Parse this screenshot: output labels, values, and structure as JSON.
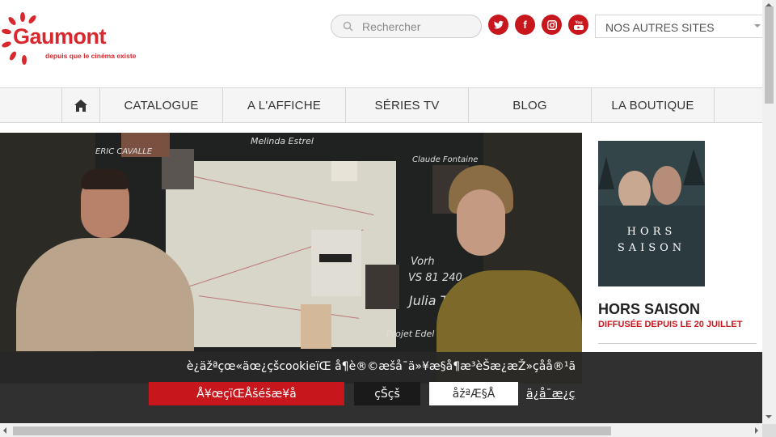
{
  "header": {
    "logo_word": "Gaumont",
    "logo_tagline": "depuis que le cinéma existe",
    "search_placeholder": "Rechercher",
    "social": [
      {
        "name": "twitter-icon",
        "glyph": "t"
      },
      {
        "name": "facebook-icon",
        "glyph": "f"
      },
      {
        "name": "instagram-icon",
        "glyph": "◎"
      },
      {
        "name": "youtube-icon",
        "glyph": "▶"
      }
    ],
    "sites_select": "NOS AUTRES SITES"
  },
  "nav": {
    "items": [
      "CATALOGUE",
      "A L'AFFICHE",
      "SÉRIES TV",
      "BLOG",
      "LA BOUTIQUE"
    ]
  },
  "hero": {
    "board_labels": [
      "Melinda Estrel",
      "ERIC CAVALLE",
      "Claude Fontaine",
      "Vorh",
      "VS 81 240",
      "Julia Tam",
      "Projet Edel"
    ]
  },
  "side": {
    "poster_title_1": "HORS",
    "poster_title_2": "SAISON",
    "title": "HORS SAISON",
    "subtitle": "DIFFUSÉE DEPUIS LE 20 JUILLET"
  },
  "cookie": {
    "message": "è¿äžªçœ«äœ¿çšcookieïŒ å¶è®©æšå¯ä»¥æ§å¶æ³èŠæ¿æŽ»çåå®¹ã",
    "accept_label": "Å¥œçïŒÅšéšæ¥å",
    "ok_label": "çŠçš",
    "custom_label": "åžªÆ§Å",
    "policy_label": "ä¿å¯æ¿ç"
  },
  "colors": {
    "brand_red": "#c8161d",
    "cookie_bg": "#282828"
  }
}
